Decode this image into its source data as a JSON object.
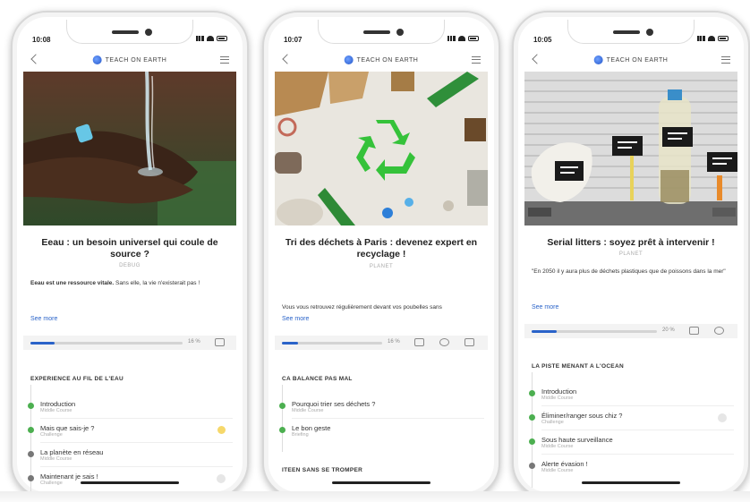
{
  "phones": [
    {
      "time": "10:08",
      "brand": "TEACH ON EARTH",
      "title": "Eeau : un besoin universel qui coule de source ?",
      "category": "DEBUG",
      "desc_bold": "Eeau est une ressource vitale.",
      "desc_rest": "Sans elle, la vie n'existerait pas !",
      "see_more": "See more",
      "progress_pct": "16 %",
      "progress_value": 0.16,
      "section": "EXPERIENCE AU FIL DE L'EAU",
      "lessons": [
        {
          "title": "Introduction",
          "sub": "Middle Course"
        },
        {
          "title": "Mais que sais-je ?",
          "sub": "Challenge"
        },
        {
          "title": "La planète en réseau",
          "sub": "Middle Course"
        },
        {
          "title": "Maintenant je sais !",
          "sub": "Challenge"
        }
      ]
    },
    {
      "time": "10:07",
      "brand": "TEACH ON EARTH",
      "title": "Tri des déchets à Paris : devenez expert en recyclage !",
      "category": "PLANET",
      "desc_rest": "Vous vous retrouvez régulièrement devant vos poubelles sans",
      "see_more": "See more",
      "progress_pct": "16 %",
      "progress_value": 0.16,
      "section": "CA BALANCE PAS MAL",
      "lessons": [
        {
          "title": "Pourquoi trier ses déchets ?",
          "sub": "Middle Course"
        },
        {
          "title": "Le bon geste",
          "sub": "Briefing"
        }
      ],
      "section2": "ITEEN SANS SE TROMPER"
    },
    {
      "time": "10:05",
      "brand": "TEACH ON EARTH",
      "title": "Serial litters : soyez prêt à intervenir !",
      "category": "PLANET",
      "desc_rest": "\"En 2050 il y aura plus de déchets plastiques que de poissons dans la mer\"",
      "see_more": "See more",
      "progress_pct": "20 %",
      "progress_value": 0.2,
      "section": "LA PISTE MENANT A L'OCEAN",
      "lessons": [
        {
          "title": "Introduction",
          "sub": "Middle Course"
        },
        {
          "title": "Éliminer/ranger sous chiz ?",
          "sub": "Challenge"
        },
        {
          "title": "Sous haute surveillance",
          "sub": "Middle Course"
        },
        {
          "title": "Alerte évasion !",
          "sub": "Middle Course"
        }
      ]
    }
  ],
  "colors": {
    "accent": "#2a63c9",
    "done": "#4caf50",
    "pending": "#777777"
  }
}
